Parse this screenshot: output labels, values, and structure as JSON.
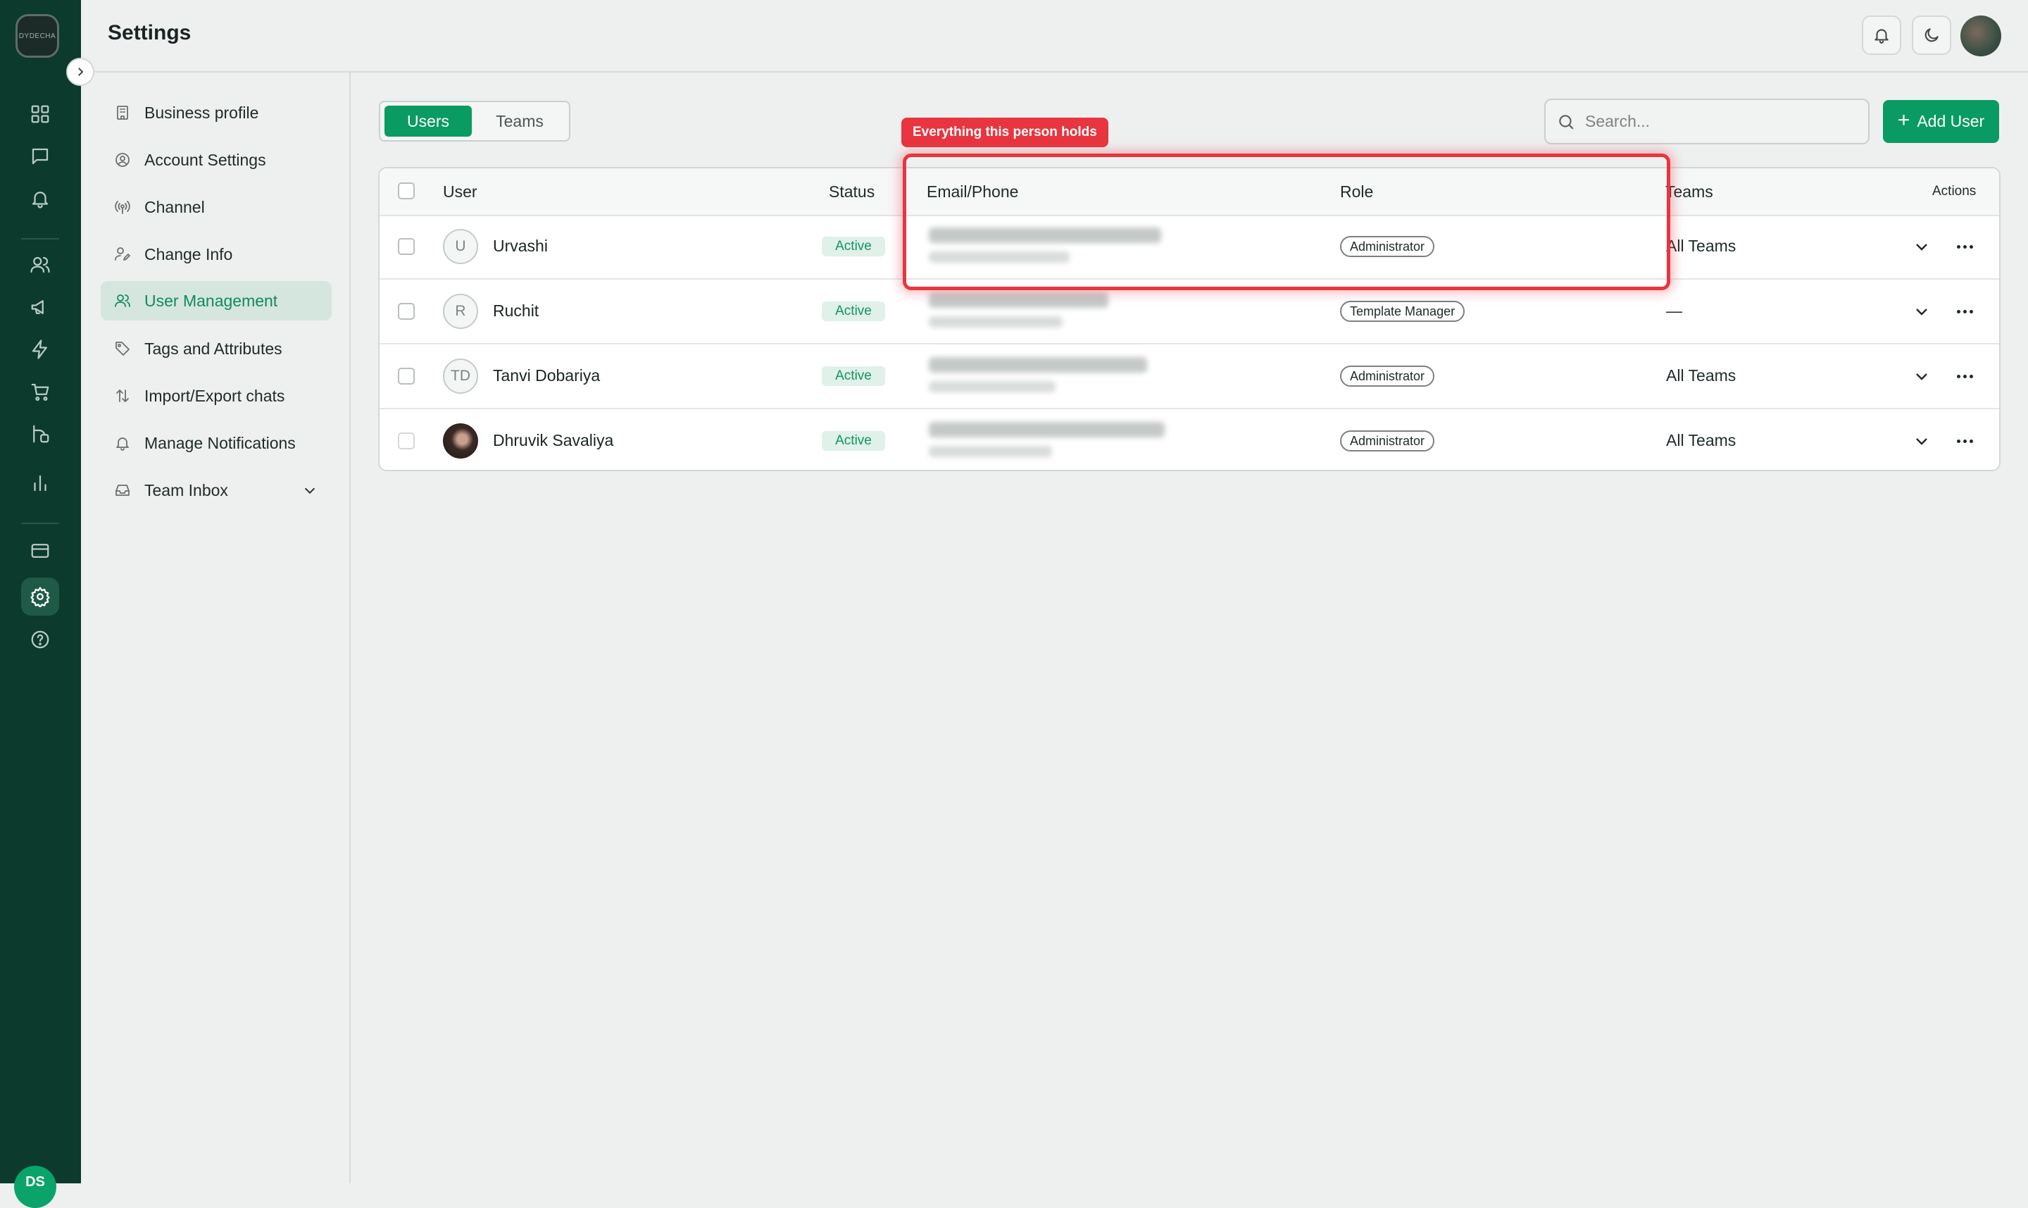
{
  "app": {
    "logo_text": "DYDECHA",
    "user_initials": "DS"
  },
  "header": {
    "title": "Settings"
  },
  "rail_icons": [
    "dashboard-icon",
    "chat-icon",
    "bell-icon",
    "contacts-icon",
    "megaphone-icon",
    "lightning-icon",
    "cart-icon",
    "integrations-icon",
    "bar-chart-icon",
    "billing-card-icon",
    "settings-gear-icon",
    "help-icon"
  ],
  "sidebar": {
    "items": [
      {
        "label": "Business profile",
        "icon": "building-icon"
      },
      {
        "label": "Account Settings",
        "icon": "account-circle-icon"
      },
      {
        "label": "Channel",
        "icon": "broadcast-icon"
      },
      {
        "label": "Change Info",
        "icon": "user-edit-icon"
      },
      {
        "label": "User Management",
        "icon": "users-icon",
        "active": true
      },
      {
        "label": "Tags and Attributes",
        "icon": "tag-icon"
      },
      {
        "label": "Import/Export chats",
        "icon": "arrows-updown-icon"
      },
      {
        "label": "Manage Notifications",
        "icon": "bell-icon"
      },
      {
        "label": "Team Inbox",
        "icon": "inbox-icon",
        "expandable": true
      }
    ]
  },
  "tabs": {
    "users": "Users",
    "teams": "Teams",
    "selected": "Users"
  },
  "search": {
    "placeholder": "Search..."
  },
  "add_user_label": "Add User",
  "table": {
    "columns": {
      "user": "User",
      "status": "Status",
      "email_phone": "Email/Phone",
      "role": "Role",
      "teams": "Teams",
      "actions": "Actions"
    },
    "rows": [
      {
        "initials": "U",
        "name": "Urvashi",
        "status": "Active",
        "role": "Administrator",
        "teams": "All Teams",
        "email_blurred": true
      },
      {
        "initials": "R",
        "name": "Ruchit",
        "status": "Active",
        "role": "Template Manager",
        "teams": "—",
        "email_blurred": true
      },
      {
        "initials": "TD",
        "name": "Tanvi Dobariya",
        "status": "Active",
        "role": "Administrator",
        "teams": "All Teams",
        "email_blurred": true
      },
      {
        "initials": "",
        "name": "Dhruvik Savaliya",
        "status": "Active",
        "role": "Administrator",
        "teams": "All Teams",
        "email_blurred": true,
        "photo": true
      }
    ]
  },
  "annotation": {
    "label": "Everything this person holds",
    "color": "#e8353f"
  },
  "colors": {
    "brand_green": "#0a9b62",
    "rail_bg": "#0c3a2c"
  }
}
